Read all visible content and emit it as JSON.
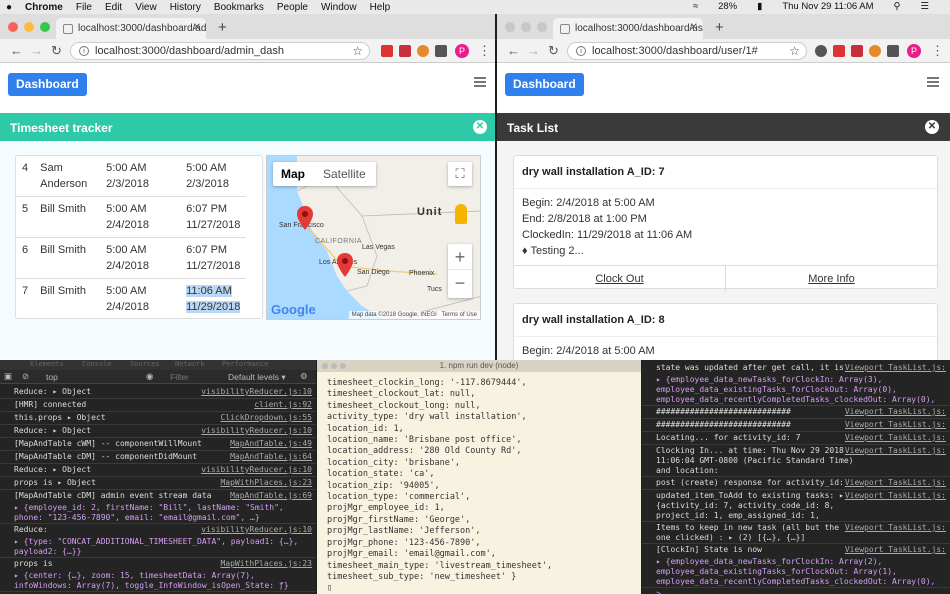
{
  "menubar": {
    "app_name": "Chrome",
    "items": [
      "File",
      "Edit",
      "View",
      "History",
      "Bookmarks",
      "People",
      "Window",
      "Help"
    ],
    "battery": "28%",
    "datetime": "Thu Nov 29  11:06 AM"
  },
  "left_window": {
    "tab_title": "localhost:3000/dashboard/adm",
    "url": "localhost:3000/dashboard/admin_dash",
    "dashboard_button": "Dashboard",
    "panel_title": "Timesheet tracker",
    "panel_color": "#2ec9a7",
    "rows": [
      {
        "num": "4",
        "name": "Sam Anderson",
        "in_time": "5:00 AM",
        "in_date": "2/3/2018",
        "out_time": "5:00 AM",
        "out_date": "2/3/2018"
      },
      {
        "num": "5",
        "name": "Bill Smith",
        "in_time": "5:00 AM",
        "in_date": "2/4/2018",
        "out_time": "6:07 PM",
        "out_date": "11/27/2018"
      },
      {
        "num": "6",
        "name": "Bill Smith",
        "in_time": "5:00 AM",
        "in_date": "2/4/2018",
        "out_time": "6:07 PM",
        "out_date": "11/27/2018"
      },
      {
        "num": "7",
        "name": "Bill Smith",
        "in_time": "5:00 AM",
        "in_date": "2/4/2018",
        "out_time": "11:06 AM",
        "out_date": "11/29/2018"
      }
    ],
    "map": {
      "tab_map": "Map",
      "tab_satellite": "Satellite",
      "labels": [
        "Unit",
        "San Francisco",
        "CALIFORNIA",
        "Las Vegas",
        "Los Angeles",
        "San Diego",
        "Phoenix",
        "Tucs"
      ],
      "logo": "Google",
      "attribution": "Map data ©2018 Google, INEGI",
      "terms": "Terms of Use",
      "zoom_in": "+",
      "zoom_out": "−"
    }
  },
  "right_window": {
    "tab_title": "localhost:3000/dashboard/use",
    "url": "localhost:3000/dashboard/user/1#",
    "dashboard_button": "Dashboard",
    "panel_title": "Task List",
    "panel_color": "#3a3a3a",
    "cards": [
      {
        "title": "dry wall installation A_ID: 7",
        "begin": "Begin: 2/4/2018 at 5:00 AM",
        "end": "End: 2/8/2018 at 1:00 PM",
        "clocked": "ClockedIn: 11/29/2018 at 11:06 AM",
        "note": "♦ Testing 2...",
        "btn_left": "Clock Out",
        "btn_right": "More Info"
      },
      {
        "title": "dry wall installation A_ID: 8",
        "begin": "Begin: 2/4/2018 at 5:00 AM"
      }
    ]
  },
  "devtools_left": {
    "tabs": [
      "Elements",
      "Console",
      "Sources",
      "Network",
      "Performance"
    ],
    "context": "top",
    "filter_placeholder": "Filter",
    "levels": "Default levels ▾",
    "lines": [
      {
        "text": "Reduce:  ▸ Object",
        "src": "visibilityReducer.js:10"
      },
      {
        "text": "[HMR] connected",
        "src": "client.js:92"
      },
      {
        "text": "this.props ▸ Object",
        "src": "ClickDropdown.js:55"
      },
      {
        "text": "Reduce:  ▸ Object",
        "src": "visibilityReducer.js:10"
      },
      {
        "text": "[MapAndTable cWM] -- componentWillMount",
        "src": "MapAndTable.js:49"
      },
      {
        "text": "[MapAndTable cDM] -- componentDidMount",
        "src": "MapAndTable.js:64"
      },
      {
        "text": "Reduce:  ▸ Object",
        "src": "visibilityReducer.js:10"
      },
      {
        "text": "props is ▸ Object",
        "src": "MapWithPlaces.js:23"
      },
      {
        "text": "[MapAndTable cDM] admin event stream data",
        "src": "MapAndTable.js:69"
      },
      {
        "text": "▸ {employee_id: 2, firstName: \"Bill\", lastName: \"Smith\", phone: \"123-456-7890\", email: \"email@gmail.com\", …}",
        "src": ""
      },
      {
        "text": "Reduce:",
        "src": "visibilityReducer.js:10"
      },
      {
        "text": "▸ {type: \"CONCAT_ADDITIONAL_TIMESHEET_DATA\", payload1: {…}, payload2: {…}}",
        "src": ""
      },
      {
        "text": "props is",
        "src": "MapWithPlaces.js:23"
      },
      {
        "text": "▸ {center: {…}, zoom: 15, timesheetData: Array(7), infoWindows: Array(7), toggle_InfoWindow_isOpen_State: ƒ}",
        "src": ""
      }
    ]
  },
  "terminal": {
    "title": "1. npm run dev (node)",
    "lines": [
      "timesheet_clockin_long: '-117.8679444',",
      "timesheet_clockout_lat: null,",
      "timesheet_clockout_long: null,",
      "activity_type: 'dry wall installation',",
      "location_id: 1,",
      "location_name: 'Brisbane post office',",
      "location_address: '280 Old County Rd',",
      "location_city: 'brisbane',",
      "location_state: 'ca',",
      "location_zip: '94005',",
      "location_type: 'commercial',",
      "projMgr_employee_id: 1,",
      "projMgr_firstName: 'George',",
      "projMgr_lastName: 'Jefferson',",
      "projMgr_phone: '123-456-7890',",
      "projMgr_email: 'email@gmail.com',",
      "timesheet_main_type: 'livestream_timesheet',",
      "timesheet_sub_type: 'new_timesheet' }"
    ]
  },
  "devtools_right": {
    "lines": [
      {
        "text": "state was updated after get call, it is now:",
        "src": "Viewport_TaskList.js:"
      },
      {
        "text": "▸ {employee_data_newTasks_forClockIn: Array(3), employee_data_existingTasks_forClockOut: Array(0), employee_data_recentlyCompletedTasks_clockedOut: Array(0), loading: false, clicked_activity_id: 0}",
        "src": ""
      },
      {
        "text": "############################",
        "src": "Viewport_TaskList.js:"
      },
      {
        "text": "############################",
        "src": "Viewport_TaskList.js:"
      },
      {
        "text": "Locating... for activity_id:  7",
        "src": "Viewport_TaskList.js:"
      },
      {
        "text": "Clocking In... at time:  Thu Nov 29 2018 11:06:04 GMT-0800 (Pacific Standard Time)  and location:",
        "src": "Viewport_TaskList.js:"
      },
      {
        "text": "post (create) response for activity_id:  7",
        "src": "Viewport_TaskList.js:"
      },
      {
        "text": "updated_item_ToAdd to existing tasks: ▸ {activity_id: 7, activity_code_id: 8, project_id: 1, emp_assigned_id: 1, emp_assigned_to: 2, …}",
        "src": "Viewport_TaskList.js:"
      },
      {
        "text": "Items to keep in new task (all but the one clicked) :  ▸ (2) [{…}, {…}]",
        "src": "Viewport_TaskList.js:"
      },
      {
        "text": "[ClockIn] State is now",
        "src": "Viewport_TaskList.js:"
      },
      {
        "text": "▸ {employee_data_newTasks_forClockIn: Array(2), employee_data_existingTasks_forClockOut: Array(1), employee_data_recentlyCompletedTasks_clockedOut: Array(0), loading: false, clicked_activity_id: 7}",
        "src": ""
      }
    ]
  }
}
